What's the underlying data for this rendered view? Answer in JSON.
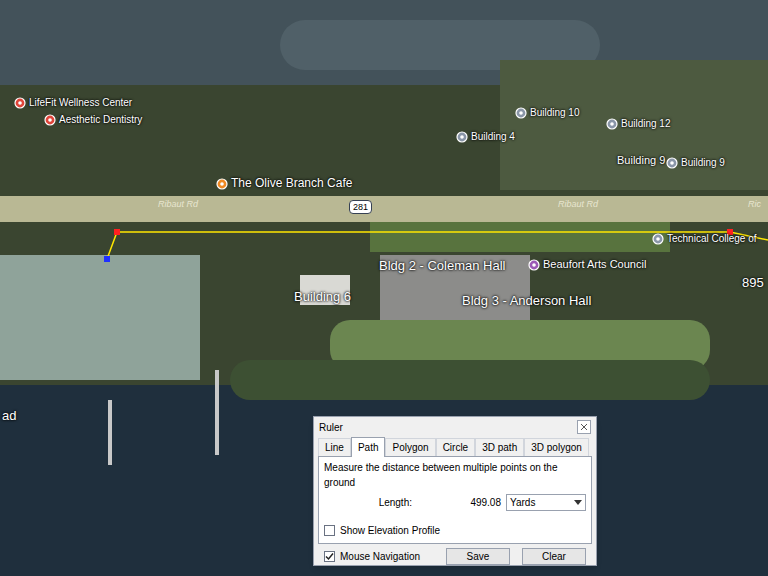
{
  "map": {
    "labels": [
      {
        "text": "LifeFit Wellness Center",
        "kind": "poi",
        "color": "#e0453a"
      },
      {
        "text": "Aesthetic Dentistry",
        "kind": "poi",
        "color": "#e0453a"
      },
      {
        "text": "The Olive Branch Cafe",
        "kind": "poi",
        "color": "#f08a24"
      },
      {
        "text": "Building 10",
        "kind": "poi",
        "color": "#8a96a8"
      },
      {
        "text": "Building 12",
        "kind": "poi",
        "color": "#8a96a8"
      },
      {
        "text": "Building 4",
        "kind": "poi",
        "color": "#8a96a8"
      },
      {
        "text": "Building 9",
        "kind": "plain",
        "color": "#8a96a8"
      },
      {
        "text": "Building 9",
        "kind": "poi",
        "color": "#8a96a8"
      },
      {
        "text": "Ribaut Rd",
        "kind": "road",
        "color": "#c9c7a8"
      },
      {
        "text": "Ribaut Rd",
        "kind": "road",
        "color": "#c9c7a8"
      },
      {
        "text": "Ric",
        "kind": "road",
        "color": "#c9c7a8"
      },
      {
        "text": "281",
        "kind": "shield",
        "color": "#ffffff"
      },
      {
        "text": "Building 6",
        "kind": "plain",
        "color": "#8a96a8"
      },
      {
        "text": "Bldg 2 - Coleman Hall",
        "kind": "plain",
        "color": "#8a96a8"
      },
      {
        "text": "Bldg 3 - Anderson Hall",
        "kind": "plain",
        "color": "#8a96a8"
      },
      {
        "text": "Beaufort Arts Council",
        "kind": "poi",
        "color": "#9b59b6"
      },
      {
        "text": "Technical College of",
        "kind": "poi",
        "color": "#8a96a8"
      },
      {
        "text": "895",
        "kind": "plain",
        "color": "#8a96a8"
      },
      {
        "text": "ad",
        "kind": "plain",
        "color": "#8a96a8"
      }
    ]
  },
  "ruler": {
    "title": "Ruler",
    "tabs": [
      {
        "label": "Line",
        "selected": false
      },
      {
        "label": "Path",
        "selected": true
      },
      {
        "label": "Polygon",
        "selected": false
      },
      {
        "label": "Circle",
        "selected": false
      },
      {
        "label": "3D path",
        "selected": false
      },
      {
        "label": "3D polygon",
        "selected": false
      }
    ],
    "description": "Measure the distance between multiple points on the ground",
    "length_label": "Length:",
    "length_value": "499.08",
    "unit": "Yards",
    "show_elevation_profile": {
      "label": "Show Elevation Profile",
      "checked": false
    },
    "mouse_navigation": {
      "label": "Mouse Navigation",
      "checked": true
    },
    "buttons": [
      "Save",
      "Clear"
    ]
  }
}
